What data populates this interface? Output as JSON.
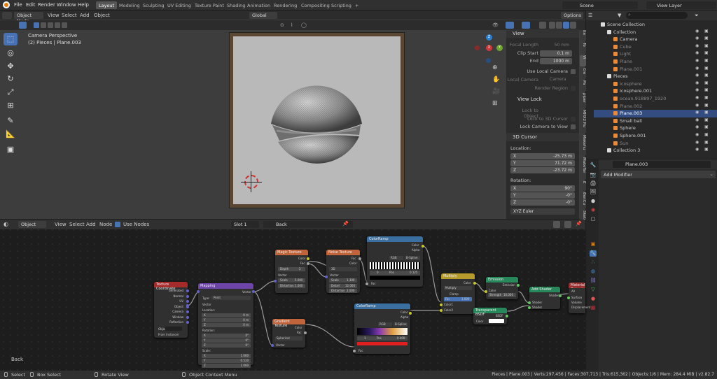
{
  "menu": [
    "File",
    "Edit",
    "Render",
    "Window",
    "Help"
  ],
  "workspaces": [
    "Layout",
    "Modeling",
    "Sculpting",
    "UV Editing",
    "Texture Paint",
    "Shading",
    "Animation",
    "Rendering",
    "Compositing",
    "Scripting"
  ],
  "active_workspace": "Layout",
  "scene_name": "Scene",
  "view_layer": "View Layer",
  "viewport": {
    "mode": "Object Mode",
    "menus": [
      "View",
      "Select",
      "Add",
      "Object"
    ],
    "orientation": "Global",
    "options": "Options",
    "info_line1": "Camera Perspective",
    "info_line2": "(2) Pieces | Plane.003",
    "gizmo_z": "Z",
    "gizmo_y": "Y",
    "gizmo_x": "X"
  },
  "npanel": {
    "view_header": "View",
    "focal_length_label": "Focal Length",
    "focal_length": "50 mm",
    "clip_start_label": "Clip Start",
    "clip_start": "0.1 m",
    "end_label": "End",
    "end": "1000 m",
    "use_local_camera": "Use Local Camera",
    "local_camera_label": "Local Camera",
    "local_camera": "Camera",
    "render_region": "Render Region",
    "view_lock_header": "View Lock",
    "lock_to_object": "Lock to Object",
    "lock_3d_cursor": "Lock to 3D Cursor",
    "lock_camera": "Lock Camera to View",
    "cursor_header": "3D Cursor",
    "location_label": "Location:",
    "loc": [
      {
        "axis": "X",
        "value": "-25.73 m"
      },
      {
        "axis": "Y",
        "value": "71.72 m"
      },
      {
        "axis": "Z",
        "value": "-23.72 m"
      }
    ],
    "rotation_label": "Rotation:",
    "rot": [
      {
        "axis": "X",
        "value": "90°"
      },
      {
        "axis": "Y",
        "value": "-0°"
      },
      {
        "axis": "Z",
        "value": "-0°"
      }
    ],
    "rotation_mode": "XYZ Euler",
    "tabs": [
      "Ite",
      "To",
      "Vi",
      "Cre",
      "Pa",
      "piper",
      "MHX2 Ru",
      "Makehu",
      "MakeTar",
      "E",
      "BonCu",
      "Sketc"
    ]
  },
  "outliner": {
    "rows": [
      {
        "name": "Scene Collection",
        "indent": 0,
        "color": "#ccc",
        "icon": "scene-collection-icon"
      },
      {
        "name": "Collection",
        "indent": 1,
        "color": "#ccc",
        "icon": "collection-icon"
      },
      {
        "name": "Camera",
        "indent": 2,
        "color": "#ccc",
        "icon": "camera-icon"
      },
      {
        "name": "Cube",
        "indent": 2,
        "color": "#888",
        "icon": "mesh-icon"
      },
      {
        "name": "Light",
        "indent": 2,
        "color": "#888",
        "icon": "light-icon"
      },
      {
        "name": "Plane",
        "indent": 2,
        "color": "#888",
        "icon": "mesh-icon"
      },
      {
        "name": "Plane.001",
        "indent": 2,
        "color": "#888",
        "icon": "mesh-icon"
      },
      {
        "name": "Pieces",
        "indent": 1,
        "color": "#ccc",
        "icon": "collection-icon"
      },
      {
        "name": "Icosphere",
        "indent": 2,
        "color": "#888",
        "icon": "mesh-icon"
      },
      {
        "name": "Icosphere.001",
        "indent": 2,
        "color": "#ccc",
        "icon": "mesh-icon"
      },
      {
        "name": "ocean.918897_1920",
        "indent": 2,
        "color": "#888",
        "icon": "mesh-icon"
      },
      {
        "name": "Plane.002",
        "indent": 2,
        "color": "#888",
        "icon": "mesh-icon"
      },
      {
        "name": "Plane.003",
        "indent": 2,
        "color": "#fff",
        "icon": "mesh-icon",
        "selected": true
      },
      {
        "name": "Small ball",
        "indent": 2,
        "color": "#ccc",
        "icon": "mesh-icon"
      },
      {
        "name": "Sphere",
        "indent": 2,
        "color": "#ccc",
        "icon": "mesh-icon"
      },
      {
        "name": "Sphere.001",
        "indent": 2,
        "color": "#ccc",
        "icon": "mesh-icon"
      },
      {
        "name": "Sun",
        "indent": 2,
        "color": "#888",
        "icon": "light-icon"
      },
      {
        "name": "Collection 3",
        "indent": 1,
        "color": "#ccc",
        "icon": "collection-icon"
      }
    ]
  },
  "properties": {
    "object_name": "Plane.003",
    "add_modifier": "Add Modifier"
  },
  "node_editor": {
    "editor_type": "Object",
    "menus": [
      "View",
      "Select",
      "Add",
      "Node"
    ],
    "use_nodes": "Use Nodes",
    "slot": "Slot 1",
    "material": "Back",
    "breadcrumb": "Back"
  },
  "nodes": {
    "texcoord": {
      "title": "Texture Coordinate",
      "outputs": [
        "Generated",
        "Normal",
        "UV",
        "Object",
        "Camera",
        "Window",
        "Reflection"
      ],
      "object_label": "Object",
      "from_instancer": "From Instancer"
    },
    "mapping": {
      "title": "Mapping",
      "output": "Vector",
      "type_label": "Type:",
      "type": "Point",
      "vector": "Vector",
      "location": "Location:",
      "rotation": "Rotation:",
      "scale": "Scale:",
      "loc": [
        "0 m",
        "0 m",
        "0 m"
      ],
      "rot": [
        "0°",
        "0°",
        "0°"
      ],
      "scl": [
        "1.000",
        "0.510",
        "1.000"
      ]
    },
    "magic": {
      "title": "Magic Texture",
      "out_color": "Color",
      "out_fac": "Fac",
      "depth_label": "Depth",
      "depth": "2",
      "vector": "Vector",
      "scale_label": "Scale",
      "scale": "5.000",
      "distortion_label": "Distortion",
      "distortion": "1.000"
    },
    "noise": {
      "title": "Noise Texture",
      "out_fac": "Fac",
      "out_color": "Color",
      "dim": "3D",
      "vector": "Vector",
      "scale_label": "Scale",
      "scale": "1.300",
      "detail_label": "Detail",
      "detail": "12.000",
      "distortion_label": "Distortion",
      "distortion": "2.000"
    },
    "ramp1": {
      "title": "ColorRamp",
      "out_color": "Color",
      "out_alpha": "Alpha",
      "mode": "RGB",
      "interp": "B-Spline",
      "pos_label": "Pos",
      "pos": "0.125",
      "index": "0",
      "fac": "Fac"
    },
    "gradient": {
      "title": "Gradient Texture",
      "out_color": "Color",
      "out_fac": "Fac",
      "type": "Spherical",
      "vector": "Vector"
    },
    "ramp2": {
      "title": "ColorRamp",
      "out_color": "Color",
      "out_alpha": "Alpha",
      "mode": "RGB",
      "interp": "B-Spline",
      "pos_label": "Pos",
      "pos": "0.400",
      "index": "1",
      "fac": "Fac"
    },
    "mix": {
      "title": "Multiply",
      "out": "Color",
      "blend": "Multiply",
      "clamp": "Clamp",
      "fac_label": "Fac",
      "fac": "1.000",
      "in1": "Color1",
      "in2": "Color2"
    },
    "emission": {
      "title": "Emission",
      "out": "Emission",
      "color": "Color",
      "strength_label": "Strength",
      "strength": "10.000"
    },
    "transparent": {
      "title": "Transparent BSDF",
      "out": "BSDF",
      "color": "Color"
    },
    "addshader": {
      "title": "Add Shader",
      "out": "Shader",
      "in1": "Shader",
      "in2": "Shader"
    },
    "output": {
      "title": "Material Output",
      "target": "All",
      "surface": "Surface",
      "volume": "Volume",
      "displacement": "Displacement"
    }
  },
  "statusbar": {
    "select": "Select",
    "box_select": "Box Select",
    "rotate_view": "Rotate View",
    "context_menu": "Object Context Menu",
    "stats": "Pieces | Plane.003 | Verts:297,456 | Faces:307,713 | Tris:615,362 | Objects:1/6 | Mem: 284.4 MiB | v2.82.7"
  },
  "colors": {
    "accent": "#4772b3",
    "selected_row": "#334d80",
    "node_texture": "#c2643b",
    "node_converter": "#3b6fa0",
    "node_shader": "#27885c",
    "node_output": "#9b2f2f",
    "node_input": "#a52a2a",
    "node_vector": "#6e44a8"
  }
}
